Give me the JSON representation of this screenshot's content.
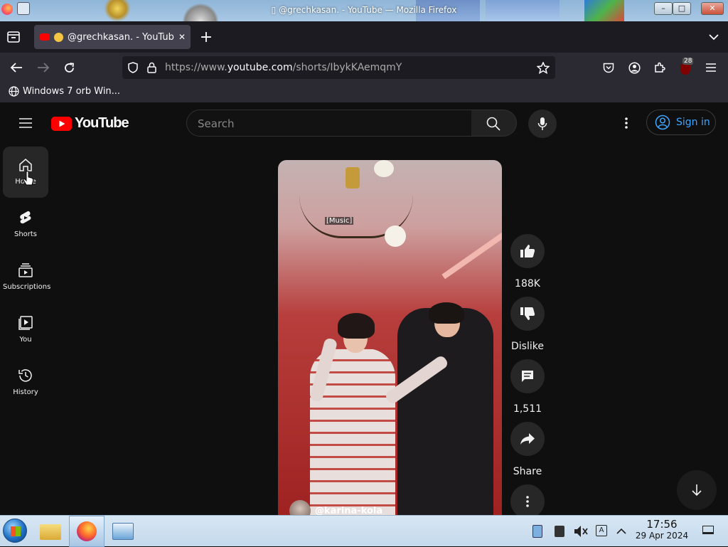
{
  "window": {
    "title": "▯ @grechkasan. - YouTube — Mozilla Firefox",
    "minimize_glyph": "–",
    "maximize_glyph": "□",
    "close_glyph": "✕"
  },
  "browser": {
    "tab": {
      "title": "@grechkasan. - YouTube",
      "close_glyph": "✕"
    },
    "new_tab_glyph": "+",
    "tab_list_glyph": "⌄",
    "url": {
      "prefix": "https://www.",
      "domain": "youtube.com",
      "path": "/shorts/IbykKAemqmY"
    },
    "extension_badge": "28",
    "bookmark": {
      "label": "Windows 7 orb Win..."
    }
  },
  "youtube": {
    "logo_text": "YouTube",
    "search_placeholder": "Search",
    "sign_in": "Sign in",
    "sidebar": [
      {
        "label": "Home",
        "icon": "home-icon"
      },
      {
        "label": "Shorts",
        "icon": "shorts-icon"
      },
      {
        "label": "Subscriptions",
        "icon": "subscriptions-icon"
      },
      {
        "label": "You",
        "icon": "you-icon"
      },
      {
        "label": "History",
        "icon": "history-icon"
      }
    ],
    "video": {
      "caption": "[Music]",
      "channel": "@karina-kola"
    },
    "actions": {
      "like": "188K",
      "dislike": "Dislike",
      "comments": "1,511",
      "share": "Share"
    }
  },
  "taskbar": {
    "time": "17:56",
    "date": "29 Apr 2024"
  },
  "colors": {
    "yt_red": "#ff0000",
    "link_blue": "#3ea6ff",
    "background": "#0f0f0f"
  }
}
